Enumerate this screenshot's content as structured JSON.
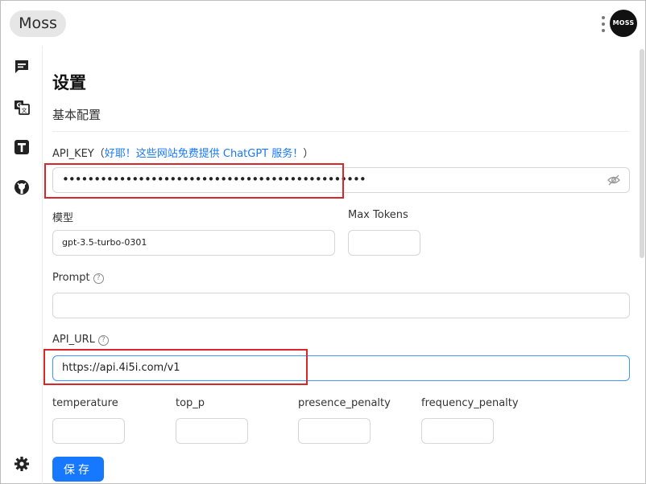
{
  "header": {
    "app_name": "Moss",
    "avatar_text": "MOSS"
  },
  "sidebar": {
    "items": [
      {
        "name": "chat",
        "icon": "chat-icon"
      },
      {
        "name": "translate",
        "icon": "translate-icon"
      },
      {
        "name": "text",
        "icon": "text-icon"
      },
      {
        "name": "github",
        "icon": "github-icon"
      }
    ],
    "settings_icon": "gear-icon"
  },
  "settings": {
    "title": "设置",
    "section": "基本配置",
    "api_key": {
      "label": "API_KEY（",
      "link": "好耶！这些网站免费提供 ChatGPT 服务！",
      "label_end": "）",
      "value": "••••••••••••••••••••••••••••••••••••••••••••••••"
    },
    "model": {
      "label": "模型",
      "value": "gpt-3.5-turbo-0301"
    },
    "max_tokens": {
      "label": "Max Tokens",
      "value": ""
    },
    "prompt": {
      "label": "Prompt",
      "value": ""
    },
    "api_url": {
      "label": "API_URL",
      "value": "https://api.4i5i.com/v1"
    },
    "params": [
      {
        "label": "temperature",
        "value": ""
      },
      {
        "label": "top_p",
        "value": ""
      },
      {
        "label": "presence_penalty",
        "value": ""
      },
      {
        "label": "frequency_penalty",
        "value": ""
      }
    ],
    "save_label": "保存"
  },
  "colors": {
    "accent": "#1677ff",
    "highlight": "#d9262b"
  }
}
